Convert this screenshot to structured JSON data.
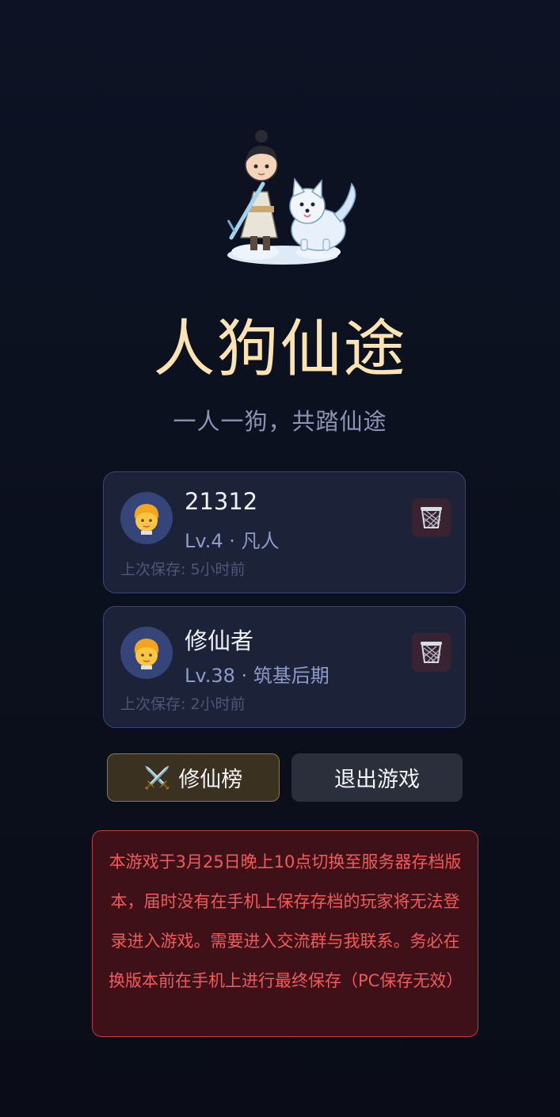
{
  "game": {
    "title": "人狗仙途",
    "subtitle": "一人一狗，共踏仙途"
  },
  "saves": [
    {
      "name": "21312",
      "level": "Lv.4 · 凡人",
      "last_saved": "上次保存: 5小时前"
    },
    {
      "name": "修仙者",
      "level": "Lv.38 · 筑基后期",
      "last_saved": "上次保存: 2小时前"
    }
  ],
  "buttons": {
    "rank_icon": "⚔️",
    "rank_label": "修仙榜",
    "exit_label": "退出游戏"
  },
  "notice": {
    "text": "本游戏于3月25日晚上10点切换至服务器存档版本，届时没有在手机上保存存档的玩家将无法登录进入游戏。需要进入交流群与我联系。务必在换版本前在手机上进行最终保存（PC保存无效）"
  },
  "colors": {
    "background": "#0d1324",
    "title": "#fbe3b2",
    "card_border": "#3a4676",
    "notice_text": "#f15a5c"
  },
  "icons": [
    "hero-cultivator-and-dog-illustration",
    "child-avatar-icon",
    "trash-basket-icon",
    "crossed-swords-icon"
  ]
}
